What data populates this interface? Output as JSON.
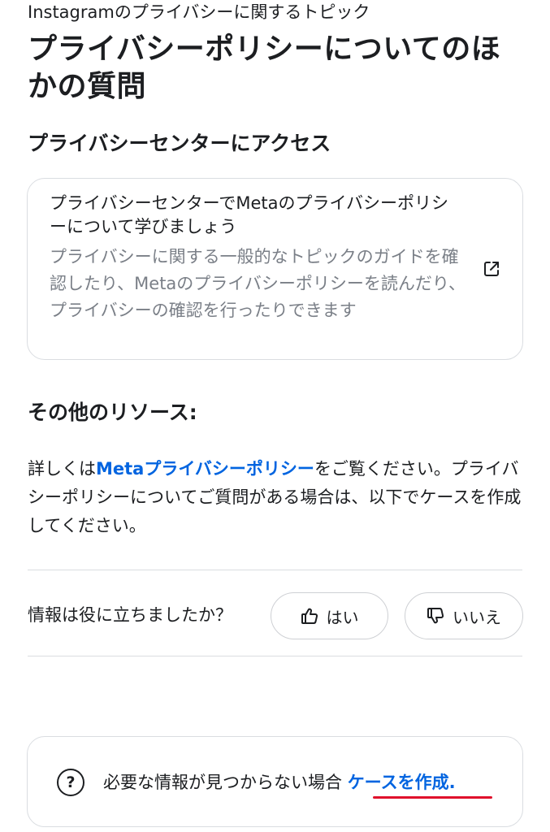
{
  "breadcrumb": "Instagramのプライバシーに関するトピック",
  "page_title": "プライバシーポリシーについてのほかの質問",
  "privacy_center": {
    "heading": "プライバシーセンターにアクセス",
    "card_title": "プライバシーセンターでMetaのプライバシーポリシーについて学びましょう",
    "card_description": "プライバシーに関する一般的なトピックのガイドを確認したり、Metaのプライバシーポリシーを読んだり、プライバシーの確認を行ったりできます",
    "card_icon": "external-link-icon"
  },
  "other_resources": {
    "heading": "その他のリソース:",
    "text_before_link": "詳しくは",
    "link_text": "Metaプライバシーポリシー",
    "text_after_link": "をご覧ください。プライバシーポリシーについてご質問がある場合は、以下でケースを作成してください。"
  },
  "feedback": {
    "question": "情報は役に立ちましたか？",
    "yes_label": "はい",
    "no_label": "いいえ",
    "yes_icon": "thumbs-up-icon",
    "no_icon": "thumbs-down-icon"
  },
  "help": {
    "icon": "question-circle-icon",
    "text": "必要な情報が見つからない場合",
    "link_text": "ケースを作成."
  },
  "colors": {
    "link": "#0064e0",
    "secondary_text": "#7a7f87",
    "border": "#dadde1",
    "annotation_underline": "#e0102b"
  }
}
